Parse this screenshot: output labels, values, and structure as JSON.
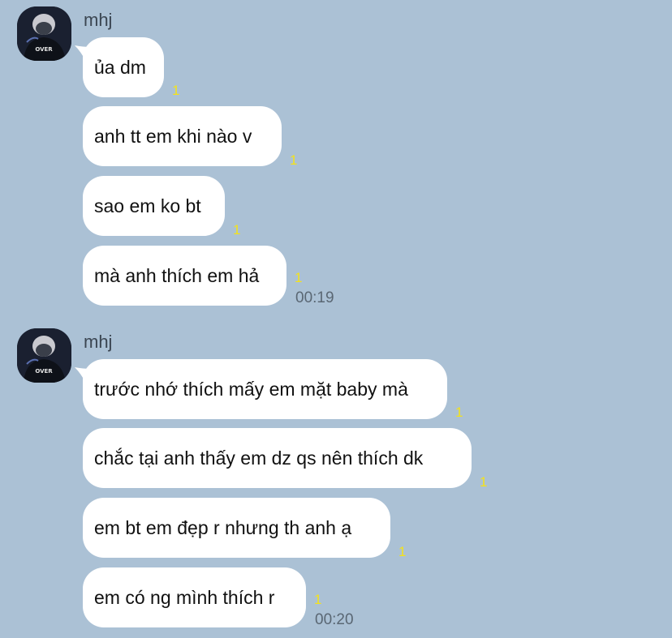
{
  "colors": {
    "background": "#abc1d5",
    "bubble": "#ffffff",
    "read_marker": "#f4e21a",
    "time": "#5a6773"
  },
  "groups": [
    {
      "sender": "mhj",
      "avatar_text": "OVER",
      "messages": [
        {
          "text": "ủa dm",
          "read": "1"
        },
        {
          "text": "anh tt em khi nào v",
          "read": "1"
        },
        {
          "text": "sao em ko bt",
          "read": "1"
        },
        {
          "text": "mà anh thích em hả",
          "read": "1",
          "time": "00:19"
        }
      ]
    },
    {
      "sender": "mhj",
      "avatar_text": "OVER",
      "messages": [
        {
          "text": "trước nhớ thích mấy em mặt baby mà",
          "read": "1"
        },
        {
          "text": "chắc tại anh thấy em dz qs nên thích dk",
          "read": "1"
        },
        {
          "text": "em bt em đẹp r nhưng th anh ạ",
          "read": "1"
        },
        {
          "text": "em có ng mình thích r",
          "read": "1",
          "time": "00:20"
        }
      ]
    }
  ]
}
